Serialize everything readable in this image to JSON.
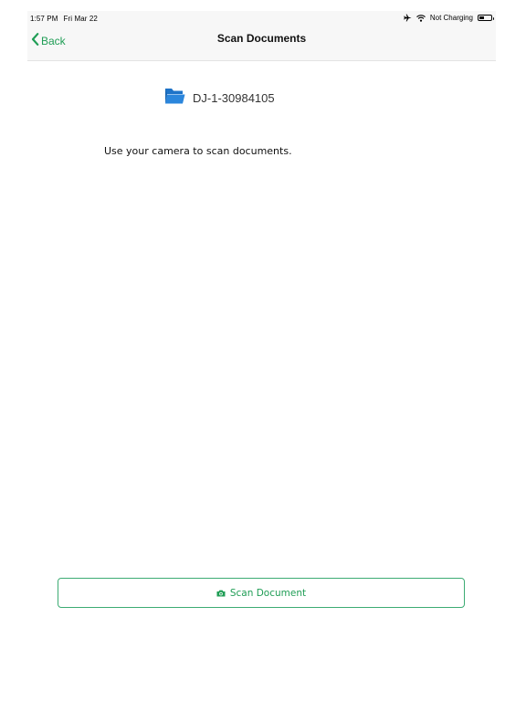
{
  "status_bar": {
    "time": "1:57 PM",
    "date": "Fri Mar 22",
    "charging_text": "Not Charging",
    "icons": [
      "airplane-icon",
      "wifi-icon",
      "battery-icon"
    ]
  },
  "nav": {
    "back_label": "Back",
    "title": "Scan Documents",
    "back_icon": "chevron-left-icon"
  },
  "folder": {
    "icon": "folder-icon",
    "label": "DJ-1-30984105"
  },
  "instructions": "Use your camera to scan documents.",
  "scan_button": {
    "icon": "camera-icon",
    "label": "Scan Document"
  },
  "colors": {
    "accent": "#1f9d55",
    "button_border": "#3cab73",
    "folder": "#1e73c8",
    "nav_background": "#f7f7f7"
  }
}
